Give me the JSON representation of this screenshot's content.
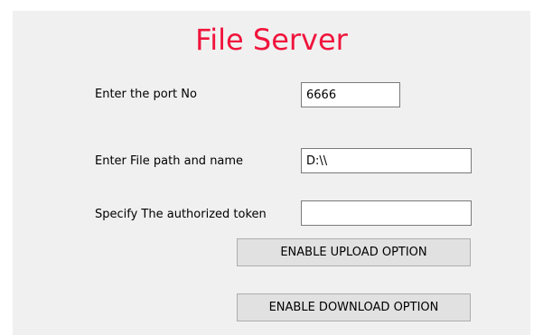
{
  "app": {
    "title": "File Server"
  },
  "form": {
    "port": {
      "label": "Enter the port No",
      "value": "6666"
    },
    "file_path": {
      "label": "Enter File path and name",
      "value": "D:\\\\"
    },
    "token": {
      "label": "Specify The authorized token",
      "value": ""
    }
  },
  "buttons": {
    "upload": "ENABLE UPLOAD OPTION",
    "download": "ENABLE DOWNLOAD OPTION"
  },
  "colors": {
    "title": "#f0143c",
    "panel_background": "#f0f0f0",
    "button_background": "#e1e1e1"
  }
}
